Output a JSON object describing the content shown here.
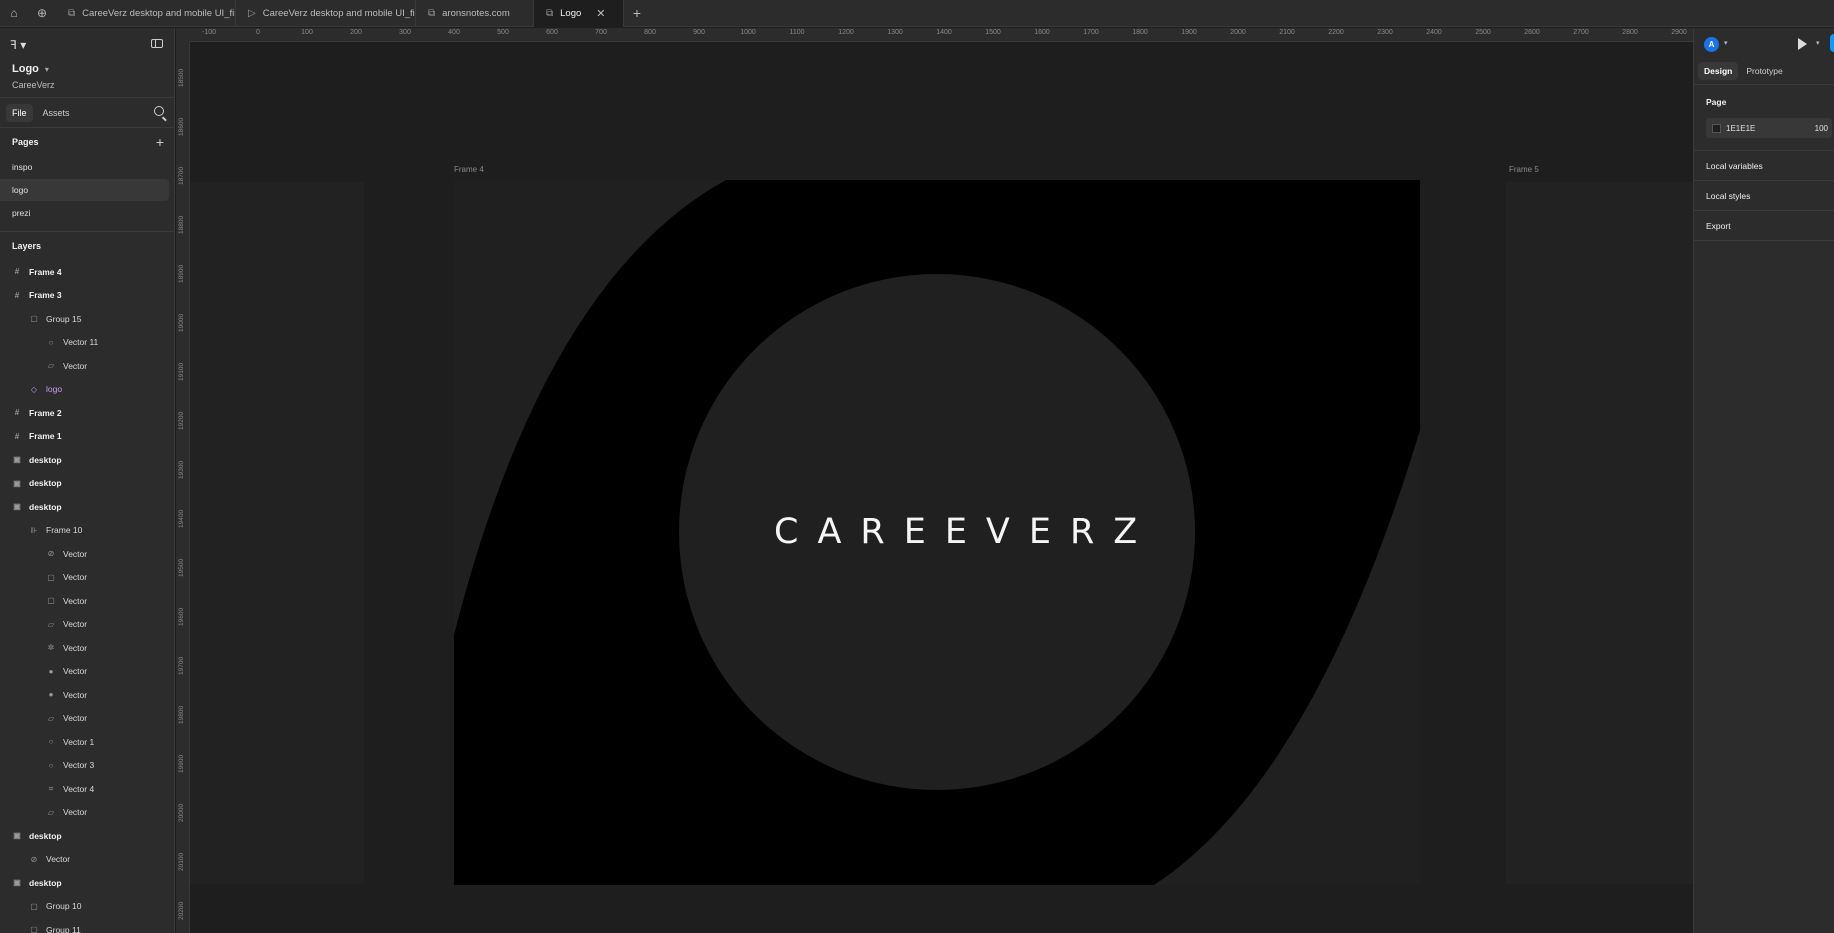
{
  "tabs": [
    {
      "label": "CareeVerz desktop and mobile UI_fin:",
      "icon": "figma-file-icon"
    },
    {
      "label": "CareeVerz desktop and mobile UI_fin:",
      "icon": "play-icon"
    },
    {
      "label": "aronsnotes.com",
      "icon": "figma-file-icon"
    },
    {
      "label": "Logo",
      "icon": "figma-file-icon",
      "active": true
    }
  ],
  "file": {
    "name": "Logo",
    "project": "CareeVerz"
  },
  "leftTabs": {
    "file": "File",
    "assets": "Assets"
  },
  "pagesTitle": "Pages",
  "pages": [
    "inspo",
    "logo",
    "prezi"
  ],
  "layersTitle": "Layers",
  "layers": [
    {
      "label": "Frame 4",
      "depth": 0,
      "icon": "#",
      "bold": true
    },
    {
      "label": "Frame 3",
      "depth": 0,
      "icon": "#",
      "bold": true
    },
    {
      "label": "Group 15",
      "depth": 1,
      "icon": "▢"
    },
    {
      "label": "Vector 11",
      "depth": 2,
      "icon": "○"
    },
    {
      "label": "Vector",
      "depth": 2,
      "icon": "▱"
    },
    {
      "label": "logo",
      "depth": 1,
      "icon": "◇",
      "component": true
    },
    {
      "label": "Frame 2",
      "depth": 0,
      "icon": "#",
      "bold": true
    },
    {
      "label": "Frame 1",
      "depth": 0,
      "icon": "#",
      "bold": true
    },
    {
      "label": "desktop",
      "depth": 0,
      "icon": "▣",
      "bold": true
    },
    {
      "label": "desktop",
      "depth": 0,
      "icon": "▣",
      "bold": true
    },
    {
      "label": "desktop",
      "depth": 0,
      "icon": "▣",
      "bold": true
    },
    {
      "label": "Frame 10",
      "depth": 1,
      "icon": "⊪"
    },
    {
      "label": "Vector",
      "depth": 2,
      "icon": "⊘"
    },
    {
      "label": "Vector",
      "depth": 2,
      "icon": "▢"
    },
    {
      "label": "Vector",
      "depth": 2,
      "icon": "▢"
    },
    {
      "label": "Vector",
      "depth": 2,
      "icon": "▱"
    },
    {
      "label": "Vector",
      "depth": 2,
      "icon": "✲"
    },
    {
      "label": "Vector",
      "depth": 2,
      "icon": "●"
    },
    {
      "label": "Vector",
      "depth": 2,
      "icon": "●"
    },
    {
      "label": "Vector",
      "depth": 2,
      "icon": "▱"
    },
    {
      "label": "Vector 1",
      "depth": 2,
      "icon": "○"
    },
    {
      "label": "Vector 3",
      "depth": 2,
      "icon": "○"
    },
    {
      "label": "Vector 4",
      "depth": 2,
      "icon": "⌗"
    },
    {
      "label": "Vector",
      "depth": 2,
      "icon": "▱"
    },
    {
      "label": "desktop",
      "depth": 0,
      "icon": "▣",
      "bold": true
    },
    {
      "label": "Vector",
      "depth": 1,
      "icon": "⊘"
    },
    {
      "label": "desktop",
      "depth": 0,
      "icon": "▣",
      "bold": true
    },
    {
      "label": "Group 10",
      "depth": 1,
      "icon": "▢"
    },
    {
      "label": "Group 11",
      "depth": 1,
      "icon": "▢"
    }
  ],
  "rulerTop": [
    "-100",
    "0",
    "100",
    "200",
    "300",
    "400",
    "500",
    "600",
    "700",
    "800",
    "900",
    "1000",
    "1100",
    "1200",
    "1300",
    "1400",
    "1500",
    "1600",
    "1700",
    "1800",
    "1900",
    "2000",
    "2100",
    "2200",
    "2300",
    "2400",
    "2500",
    "2600",
    "2700",
    "2800",
    "2900"
  ],
  "rulerLeft": [
    "18500",
    "18600",
    "18700",
    "18800",
    "18900",
    "19000",
    "19100",
    "19200",
    "19300",
    "19400",
    "19500",
    "19600",
    "19700",
    "19800",
    "19900",
    "20000",
    "20100",
    "20200"
  ],
  "canvas": {
    "frame4Label": "Frame 4",
    "frame5Label": "Frame 5",
    "logoText": "CAREEVERZ"
  },
  "right": {
    "avatar": "A",
    "tabs": {
      "design": "Design",
      "prototype": "Prototype"
    },
    "pageSection": "Page",
    "pageColor": "1E1E1E",
    "pageOpacity": "100",
    "localVariables": "Local variables",
    "localStyles": "Local styles",
    "export": "Export"
  },
  "colors": {
    "canvas": "#1e1e1e",
    "panel": "#2c2c2c",
    "accent": "#0d99ff",
    "component": "#c79cf3"
  }
}
